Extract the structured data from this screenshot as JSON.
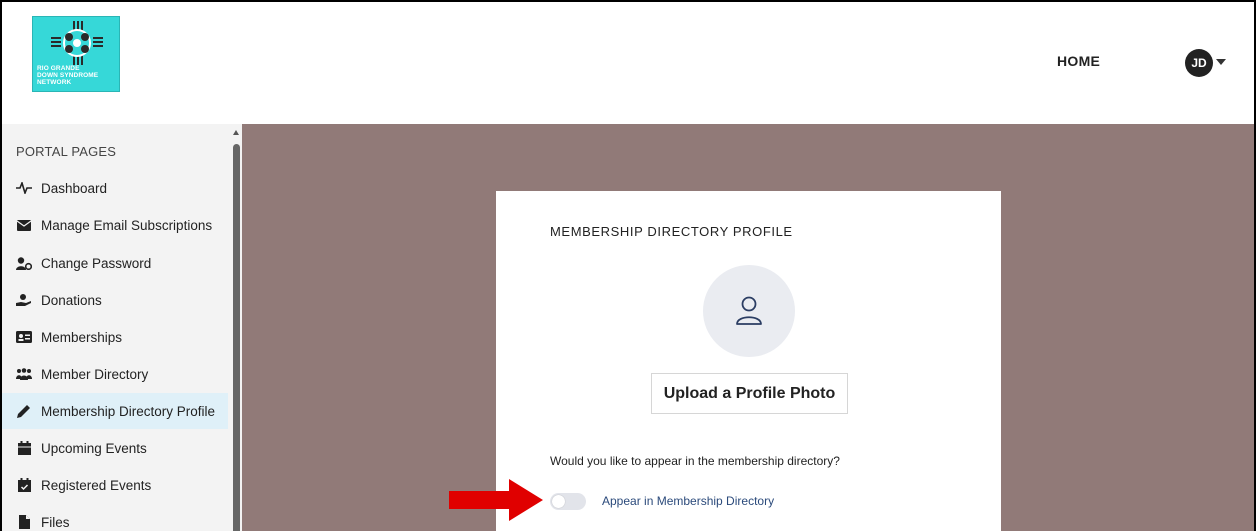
{
  "header": {
    "logo_text": [
      "RIO GRANDE",
      "DOWN SYNDROME",
      "NETWORK"
    ],
    "nav_home": "HOME",
    "avatar_initials": "JD"
  },
  "sidebar": {
    "title": "PORTAL PAGES",
    "items": [
      {
        "label": "Dashboard",
        "icon": "pulse-icon"
      },
      {
        "label": "Manage Email Subscriptions",
        "icon": "envelope-icon"
      },
      {
        "label": "Change Password",
        "icon": "user-gear-icon"
      },
      {
        "label": "Donations",
        "icon": "hand-donation-icon"
      },
      {
        "label": "Memberships",
        "icon": "id-card-icon"
      },
      {
        "label": "Member Directory",
        "icon": "users-icon"
      },
      {
        "label": "Membership Directory Profile",
        "icon": "pencil-icon",
        "active": true
      },
      {
        "label": "Upcoming Events",
        "icon": "calendar-icon"
      },
      {
        "label": "Registered Events",
        "icon": "calendar-check-icon"
      },
      {
        "label": "Files",
        "icon": "file-icon"
      }
    ]
  },
  "card": {
    "title": "MEMBERSHIP DIRECTORY PROFILE",
    "upload_label": "Upload a Profile Photo",
    "question": "Would you like to appear in the membership directory?",
    "toggle_label": "Appear in Membership Directory",
    "toggle_on": false
  },
  "colors": {
    "main_bg": "#917a78",
    "logo_bg": "#36d8d8",
    "active_item_bg": "#dff0f8",
    "toggle_label": "#2b4a7b",
    "annotation_arrow": "#e00000"
  }
}
